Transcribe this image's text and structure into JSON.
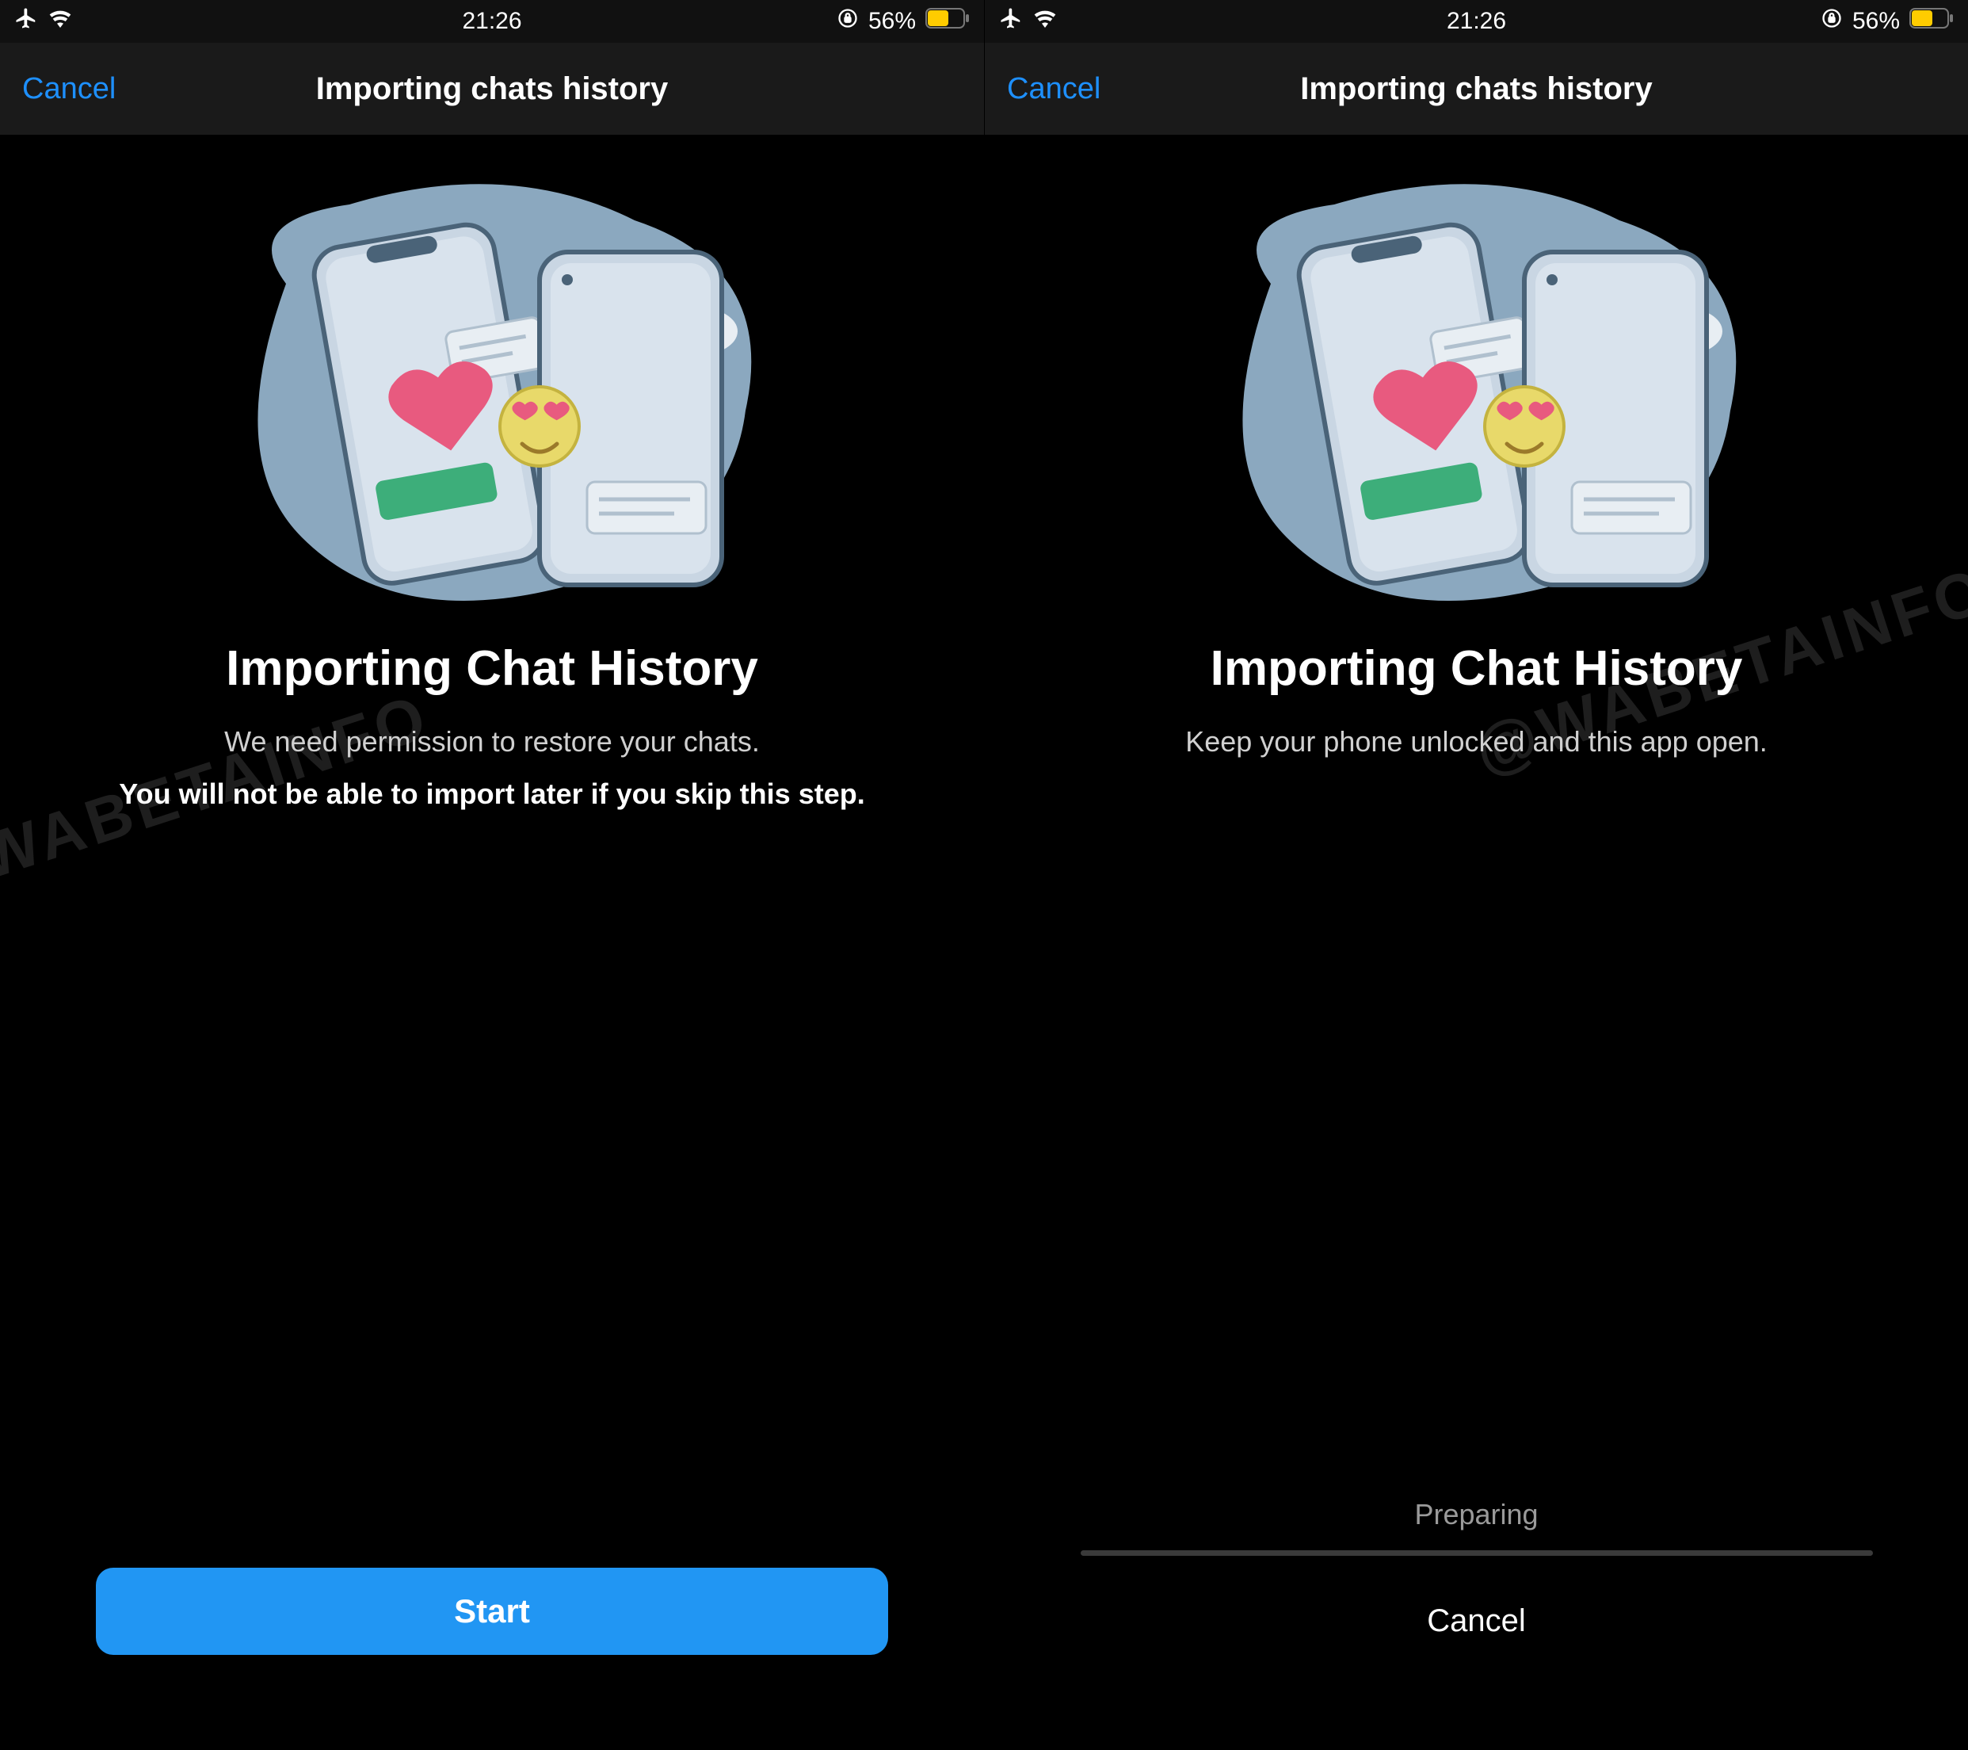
{
  "watermark": "@WABETAINFO",
  "status_bar": {
    "time": "21:26",
    "battery_percent": "56%"
  },
  "left": {
    "nav": {
      "cancel": "Cancel",
      "title": "Importing chats history"
    },
    "headline": "Importing Chat History",
    "sub1": "We need permission to restore your chats.",
    "sub2": "You will not be able to import later if you skip this step.",
    "primary_button": "Start"
  },
  "right": {
    "nav": {
      "cancel": "Cancel",
      "title": "Importing chats history"
    },
    "headline": "Importing Chat History",
    "sub1": "Keep your phone unlocked and this app open.",
    "status_text": "Preparing",
    "secondary_cancel": "Cancel"
  }
}
